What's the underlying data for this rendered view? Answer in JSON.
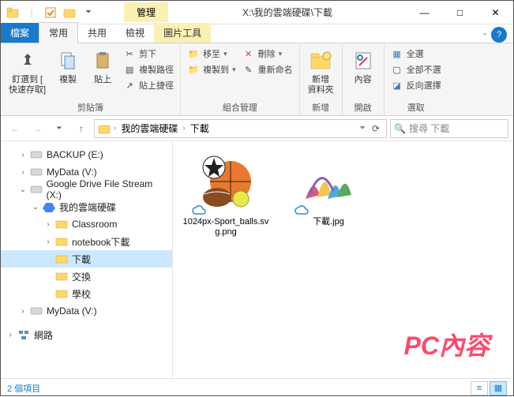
{
  "title": {
    "tab": "管理",
    "path": "X:\\我的雲端硬碟\\下載"
  },
  "win": {
    "min": "—",
    "max": "□",
    "close": "✕"
  },
  "tabs": {
    "file": "檔案",
    "home": "常用",
    "share": "共用",
    "view": "檢視",
    "tools": "圖片工具",
    "help": "?"
  },
  "ribbon": {
    "pin": {
      "label": "釘選到 [\n快速存取]"
    },
    "copy": "複製",
    "paste": "貼上",
    "cut": "剪下",
    "copypath": "複製路徑",
    "pastelink": "貼上捷徑",
    "clipgroup": "剪貼簿",
    "moveto": "移至",
    "copyto": "複製到",
    "delete": "刪除",
    "rename": "重新命名",
    "orggroup": "組合管理",
    "newfolder": "新增\n資料夾",
    "newgroup": "新增",
    "props": "內容",
    "opengroup": "開啟",
    "selectall": "全選",
    "selectnone": "全部不選",
    "invert": "反向選擇",
    "selgroup": "選取"
  },
  "addr": {
    "crumb1": "我的雲端硬碟",
    "crumb2": "下載",
    "search": "搜尋 下載"
  },
  "tree": {
    "backup": "BACKUP (E:)",
    "mydata": "MyData (V:)",
    "gdrive": "Google Drive File Stream (X:)",
    "mycloud": "我的雲端硬碟",
    "classroom": "Classroom",
    "notebook": "notebook下載",
    "download": "下載",
    "exchange": "交換",
    "school": "學校",
    "mydata2": "MyData (V:)",
    "network": "網路"
  },
  "files": {
    "f1": "1024px-Sport_balls.svg.png",
    "f2": "下載.jpg"
  },
  "watermark": "PC內容",
  "status": "2 個項目"
}
